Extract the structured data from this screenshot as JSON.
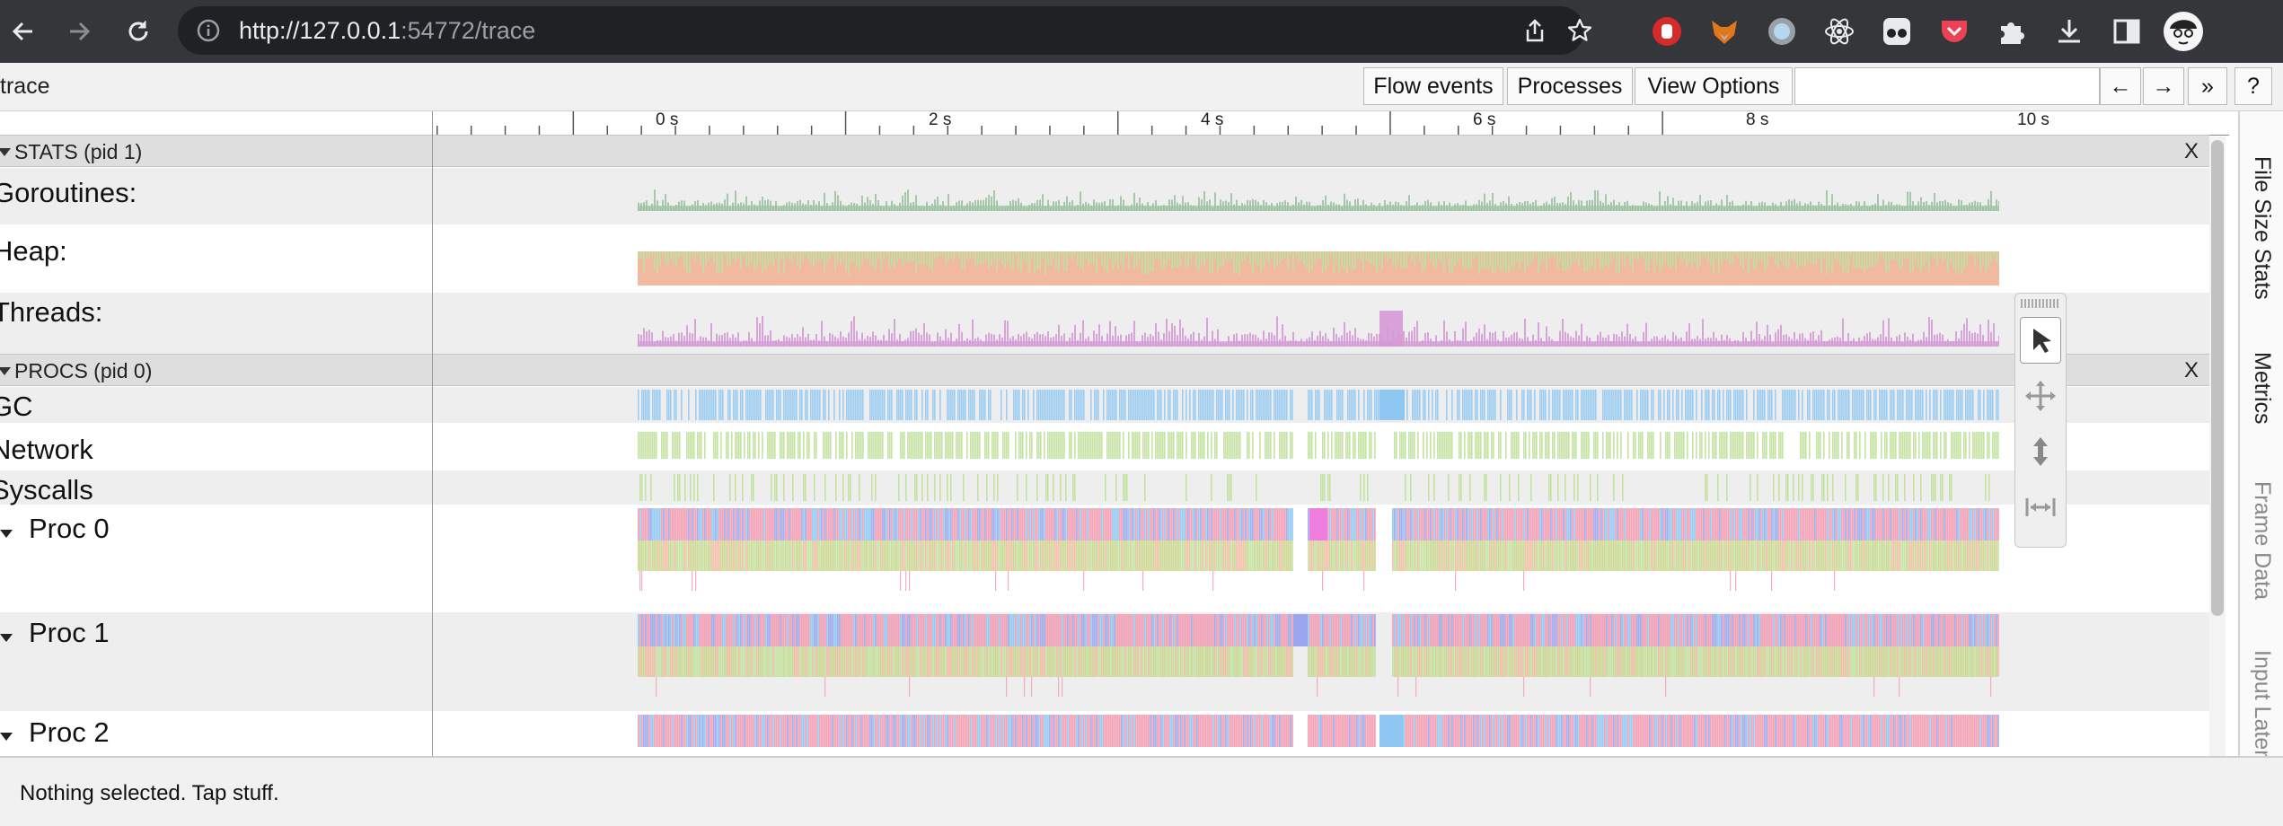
{
  "browser": {
    "url_host": "http://127.0.0.1",
    "url_rest": ":54772/trace"
  },
  "toolbar": {
    "title": "trace",
    "flow_events": "Flow events",
    "processes": "Processes",
    "view_options": "View Options",
    "nav_left": "←",
    "nav_right": "→",
    "more": "»",
    "help": "?"
  },
  "timeline": {
    "tick_labels": [
      "0 s",
      "2 s",
      "4 s",
      "6 s",
      "8 s",
      "10 s"
    ]
  },
  "stats_group": {
    "header": "STATS (pid 1)",
    "close": "X",
    "rows": [
      "Goroutines:",
      "Heap:",
      "Threads:"
    ]
  },
  "procs_group": {
    "header": "PROCS (pid 0)",
    "close": "X",
    "rows": [
      "GC",
      "Network",
      "Syscalls",
      "Proc 0",
      "Proc 1",
      "Proc 2"
    ]
  },
  "side_tabs": [
    "File Size Stats",
    "Metrics",
    "Frame Data",
    "Input Latency"
  ],
  "status": "Nothing selected. Tap stuff.",
  "colors": {
    "goroutines": "#9cc3a3",
    "heap_a": "#f0b9a0",
    "heap_b": "#bde0a0",
    "threads": "#d49ad6",
    "gc": "#8ec8f2",
    "network": "#bfe09a",
    "proc_a": "#f29bb1",
    "proc_b": "#9aa7ec",
    "proc_c": "#c8d58a"
  },
  "icons": [
    "back-icon",
    "forward-icon",
    "reload-icon",
    "info-icon",
    "share-icon",
    "star-icon",
    "puzzle-icon",
    "download-icon",
    "sidepanel-icon",
    "avatar"
  ]
}
